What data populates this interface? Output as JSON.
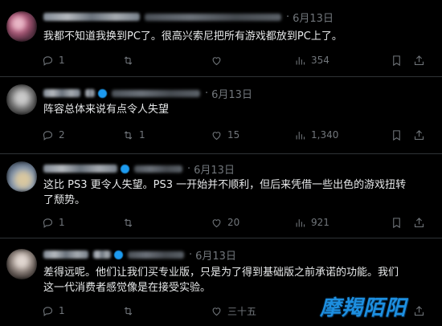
{
  "posts": [
    {
      "date": "6月13日",
      "text": "我都不知道我换到PC了。很高兴索尼把所有游戏都放到PC上了。",
      "replies": "1",
      "reposts": "",
      "likes": "",
      "views": "354"
    },
    {
      "date": "6月13日",
      "text": "阵容总体来说有点令人失望",
      "replies": "2",
      "reposts": "1",
      "likes": "15",
      "views": "1,340"
    },
    {
      "date": "6月13日",
      "text": "这比 PS3 更令人失望。PS3 一开始并不顺利，但后来凭借一些出色的游戏扭转\n了颓势。",
      "replies": "1",
      "reposts": "",
      "likes": "20",
      "views": "921"
    },
    {
      "date": "6月13日",
      "text": "差得远呢。他们让我们买专业版，只是为了得到基础版之前承诺的功能。我们\n这一代消费者感觉像是在接受实验。",
      "replies": "1",
      "reposts": "",
      "likes": "三十五",
      "views": ""
    }
  ],
  "watermark": "摩羯陌阳",
  "colors": {
    "background": "#000000",
    "text": "#e7e9ea",
    "muted": "#71767b",
    "divider": "#2f3336",
    "accent": "#1d9bf0"
  },
  "icons": {
    "reply": "reply-icon",
    "repost": "repost-icon",
    "like": "heart-icon",
    "views": "views-icon",
    "bookmark": "bookmark-icon",
    "share": "share-icon"
  }
}
